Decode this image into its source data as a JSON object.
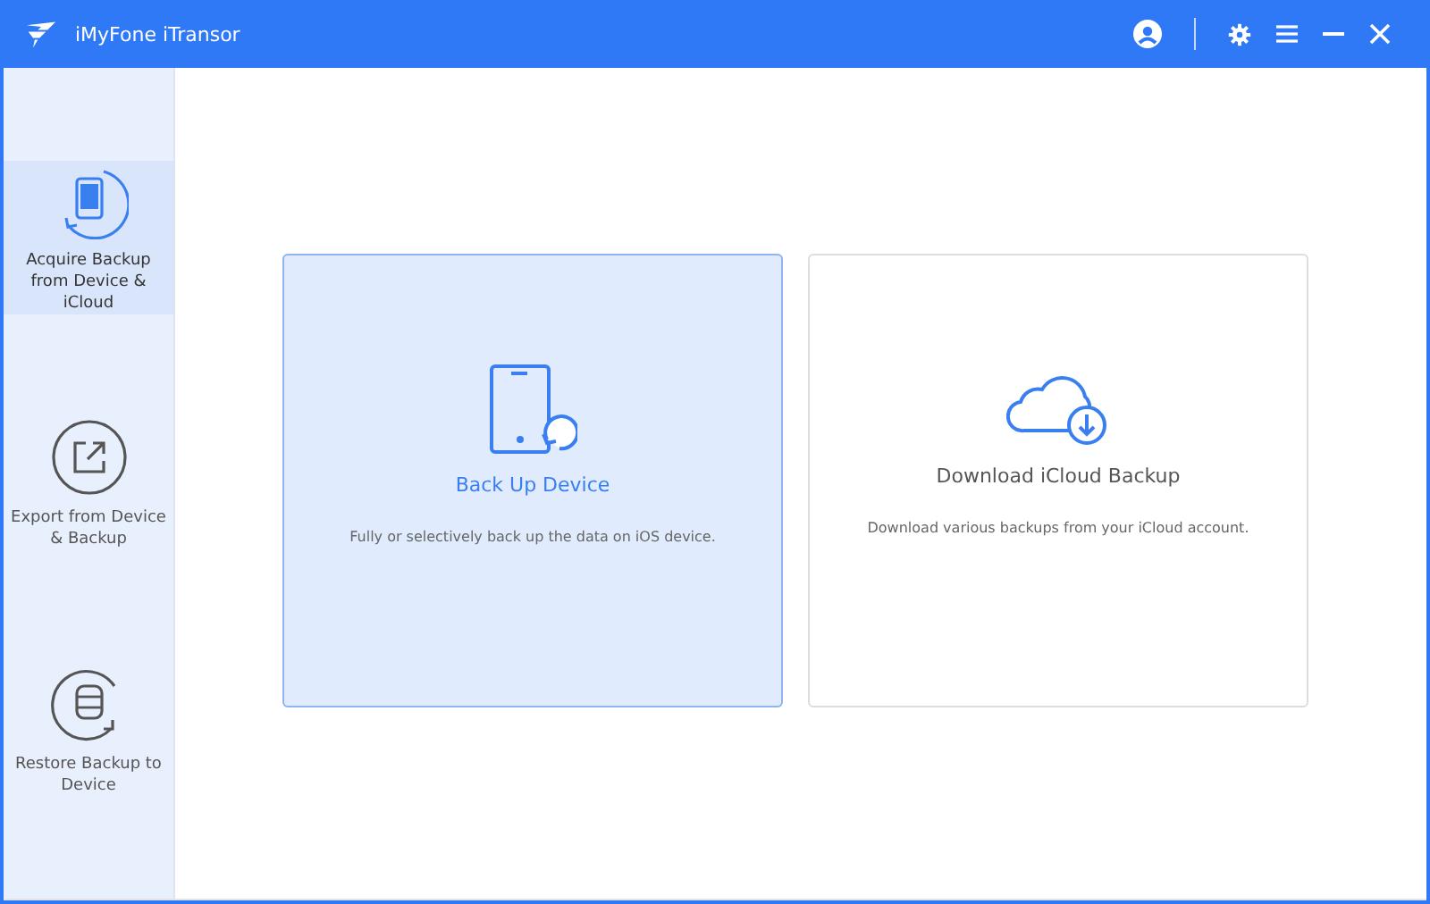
{
  "window": {
    "title": "iMyFone iTransor"
  },
  "sidebar": {
    "items": [
      {
        "kind": "acquire",
        "label": "Acquire Backup from Device & iCloud",
        "selected": true
      },
      {
        "kind": "export",
        "label": "Export from Device & Backup",
        "selected": false
      },
      {
        "kind": "restore",
        "label": "Restore Backup to Device",
        "selected": false
      }
    ]
  },
  "cards": [
    {
      "kind": "device",
      "title": "Back Up Device",
      "description": "Fully or selectively back up the data on iOS device.",
      "selected": true
    },
    {
      "kind": "icloud",
      "title": "Download iCloud Backup",
      "description": "Download various backups from your iCloud account.",
      "selected": false
    }
  ]
}
